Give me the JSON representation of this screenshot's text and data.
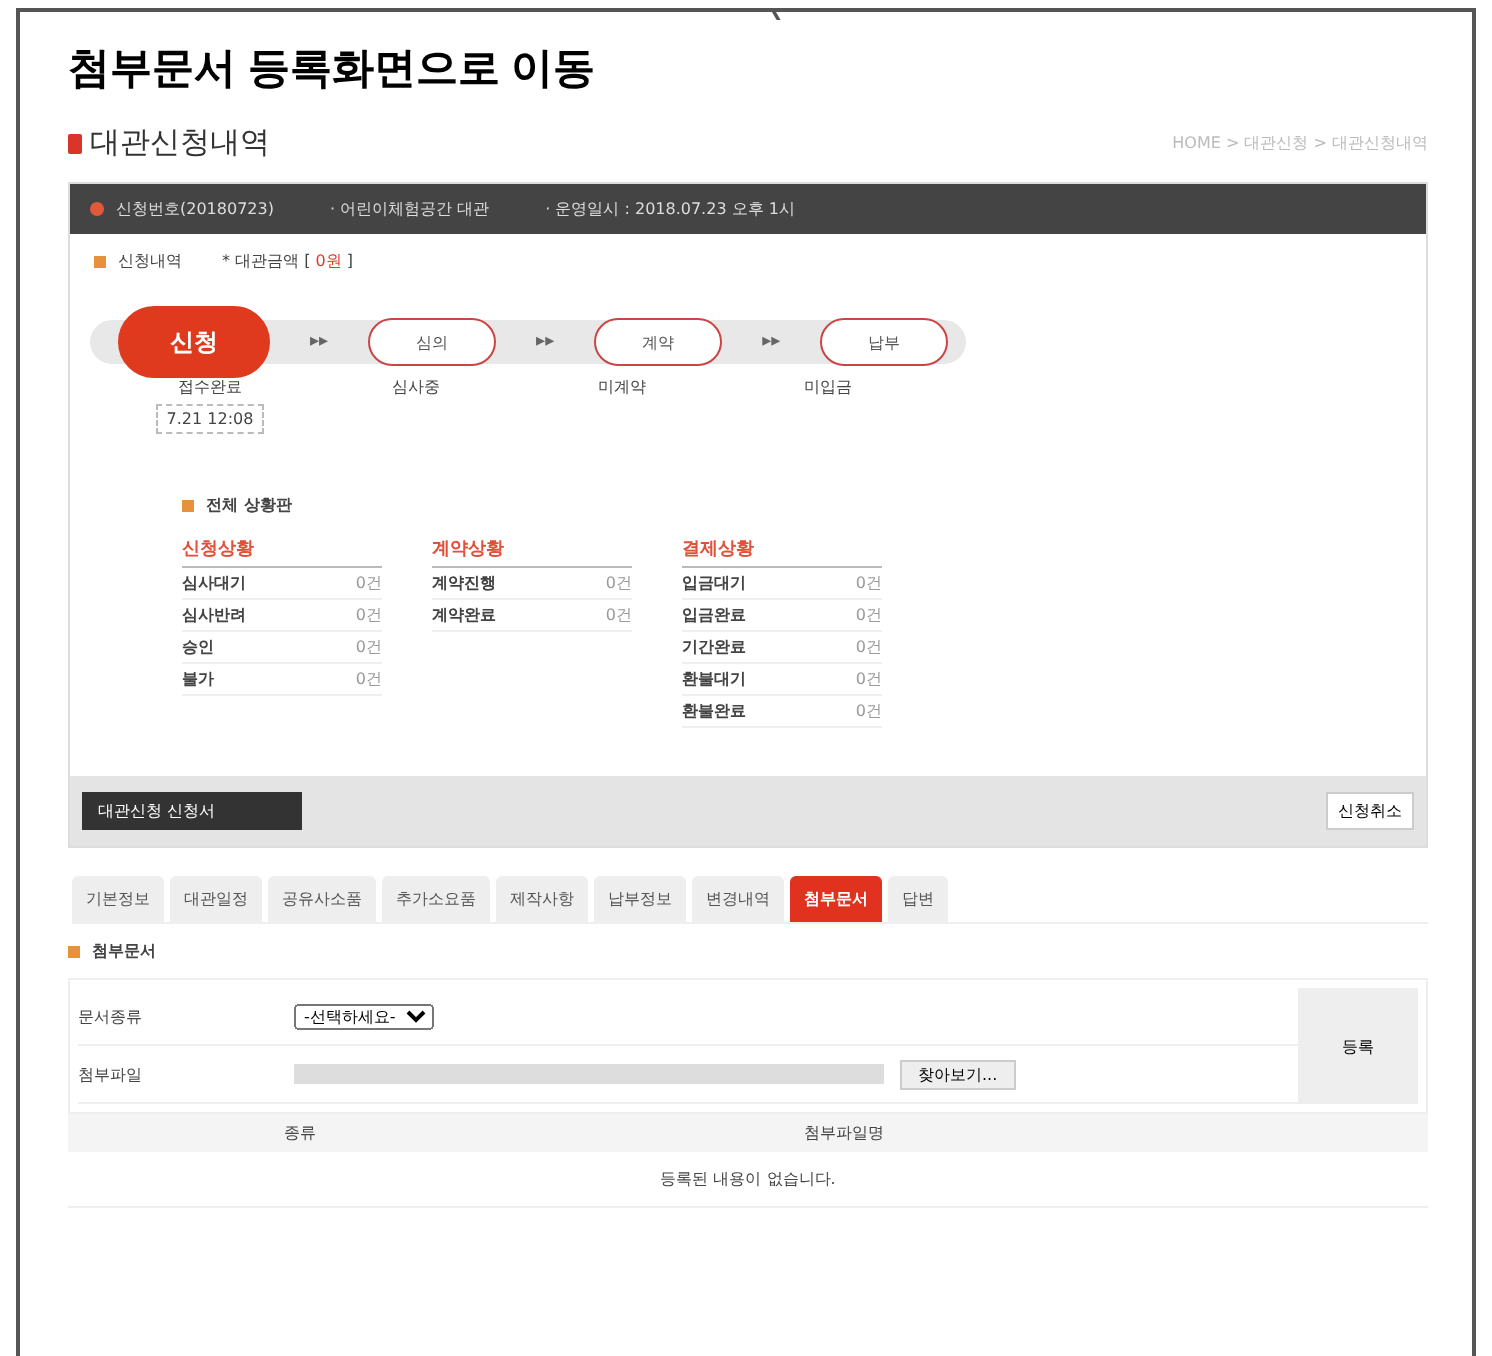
{
  "heading": "첨부문서 등록화면으로 이동",
  "page": {
    "title": "대관신청내역",
    "breadcrumb": "HOME > 대관신청 > 대관신청내역"
  },
  "info_bar": [
    "신청번호(20180723)",
    "· 어린이체험공간 대관",
    "· 운영일시 : 2018.07.23 오후 1시"
  ],
  "summary": {
    "label": "신청내역",
    "amount": "* 대관금액 [",
    "amount_value": "0원",
    "amount_close": "]"
  },
  "steps": [
    {
      "label": "신청",
      "status": "접수완료",
      "date": "7.21 12:08",
      "active": true
    },
    {
      "label": "심의",
      "status": "심사중",
      "active": false
    },
    {
      "label": "계약",
      "status": "미계약",
      "active": false
    },
    {
      "label": "납부",
      "status": "미입금",
      "active": false
    }
  ],
  "step_arrow": "▸▸",
  "board": {
    "title": "전체 상황판",
    "groups": [
      {
        "title": "신청상황",
        "rows": [
          {
            "name": "심사대기",
            "count": "0건"
          },
          {
            "name": "심사반려",
            "count": "0건"
          },
          {
            "name": "승인",
            "count": "0건"
          },
          {
            "name": "불가",
            "count": "0건"
          }
        ]
      },
      {
        "title": "계약상황",
        "rows": [
          {
            "name": "계약진행",
            "count": "0건"
          },
          {
            "name": "계약완료",
            "count": "0건"
          }
        ]
      },
      {
        "title": "결제상황",
        "rows": [
          {
            "name": "입금대기",
            "count": "0건"
          },
          {
            "name": "입금완료",
            "count": "0건"
          },
          {
            "name": "기간완료",
            "count": "0건"
          },
          {
            "name": "환불대기",
            "count": "0건"
          },
          {
            "name": "환불완료",
            "count": "0건"
          }
        ]
      }
    ]
  },
  "form_button": "대관신청 신청서",
  "cancel_button": "신청취소",
  "tabs": [
    {
      "label": "기본정보",
      "selected": false
    },
    {
      "label": "대관일정",
      "selected": false
    },
    {
      "label": "공유사소품",
      "selected": false
    },
    {
      "label": "추가소요품",
      "selected": false
    },
    {
      "label": "제작사항",
      "selected": false
    },
    {
      "label": "납부정보",
      "selected": false
    },
    {
      "label": "변경내역",
      "selected": false
    },
    {
      "label": "첨부문서",
      "selected": true
    },
    {
      "label": "답변",
      "selected": false
    }
  ],
  "attach": {
    "title": "첨부문서",
    "type_label": "문서종류",
    "type_value": "-선택하세요-",
    "file_label": "첨부파일",
    "browse": "찾아보기...",
    "register": "등록",
    "columns": [
      "종류",
      "첨부파일명"
    ],
    "empty": "등록된 내용이 없습니다."
  }
}
